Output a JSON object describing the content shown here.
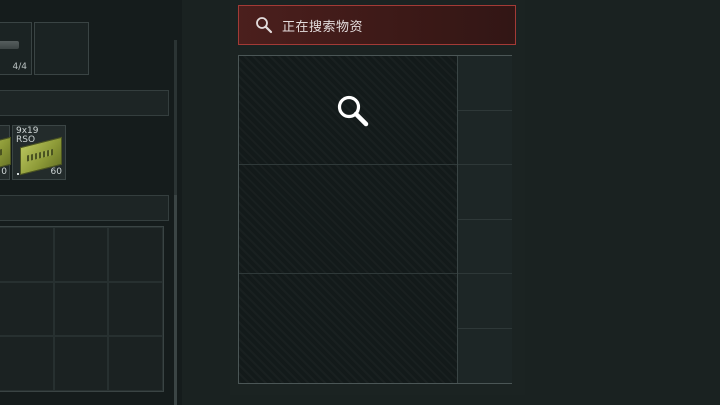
{
  "inventory": {
    "weapon_slot": {
      "count": "4/4"
    },
    "ammo": [
      {
        "name": "",
        "count": "0"
      },
      {
        "name": "9x19\nRSO",
        "count": "60"
      }
    ],
    "grid": {
      "rows": 3,
      "cols": 3
    }
  },
  "loot": {
    "search_status": "正在搜索物资",
    "icon": "magnifier-icon",
    "accent_color": "#a33a36",
    "rows": 3,
    "side_slots": 6
  }
}
